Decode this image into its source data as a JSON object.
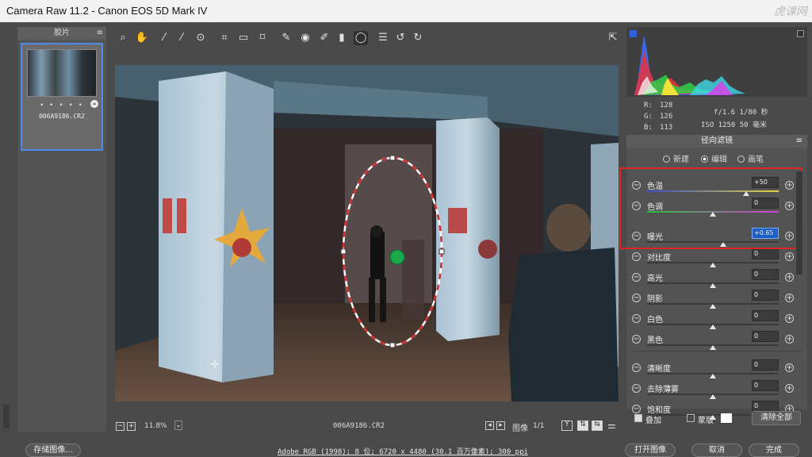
{
  "window": {
    "title": "Camera Raw 11.2 -  Canon EOS 5D Mark IV",
    "watermark": "虎课网"
  },
  "filmstrip": {
    "header": "胶片",
    "thumb_dots": "• • • • •",
    "thumb_filename": "006A9186.CR2"
  },
  "toolbar": {
    "tools": [
      "zoom-icon",
      "hand-icon",
      "white-balance-icon",
      "color-sampler-icon",
      "target-adjust-icon",
      "crop-icon",
      "straighten-icon",
      "transform-icon",
      "spot-removal-icon",
      "red-eye-icon",
      "adjustment-brush-icon",
      "graduated-filter-icon",
      "radial-filter-icon",
      "preferences-list-icon",
      "rotate-ccw-icon",
      "rotate-cw-icon"
    ],
    "fullscreen_icon": "fullscreen-icon"
  },
  "canvas": {
    "zoom": "11.8%",
    "filename": "006A9186.CR2",
    "image_label": "图像",
    "image_count": "1/1"
  },
  "histogram": {
    "colors": {
      "red": "#e8323a",
      "green": "#2fd04a",
      "blue": "#3b6cff",
      "yellow": "#f0e238",
      "magenta": "#e23ce8",
      "cyan": "#3ed8e8"
    }
  },
  "info": {
    "r_label": "R:",
    "r": "128",
    "g_label": "G:",
    "g": "126",
    "b_label": "B:",
    "b": "113",
    "aperture_shutter": "f/1.6   1/80 秒",
    "iso_focal": "ISO 1250   50 毫米"
  },
  "panel": {
    "title": "径向滤镜",
    "modes": [
      {
        "label": "新建",
        "selected": false
      },
      {
        "label": "编辑",
        "selected": true
      },
      {
        "label": "画笔",
        "selected": false
      }
    ],
    "sliders": [
      {
        "label": "色温",
        "value": "+50",
        "level": 0.75,
        "selected": false
      },
      {
        "label": "色调",
        "value": "0",
        "level": 0.5,
        "selected": false
      },
      {
        "label": "曝光",
        "value": "+0.65",
        "level": 0.58,
        "selected": true
      },
      {
        "label": "对比度",
        "value": "0",
        "level": 0.5,
        "selected": false
      },
      {
        "label": "高光",
        "value": "0",
        "level": 0.5,
        "selected": false
      },
      {
        "label": "阴影",
        "value": "0",
        "level": 0.5,
        "selected": false
      },
      {
        "label": "白色",
        "value": "0",
        "level": 0.5,
        "selected": false
      },
      {
        "label": "黑色",
        "value": "0",
        "level": 0.5,
        "selected": false
      },
      {
        "label": "清晰度",
        "value": "0",
        "level": 0.5,
        "selected": false
      },
      {
        "label": "去除薄雾",
        "value": "0",
        "level": 0.5,
        "selected": false
      },
      {
        "label": "饱和度",
        "value": "0",
        "level": 0.5,
        "selected": false
      }
    ],
    "overlay_label": "叠加",
    "mask_label": "蒙版",
    "clear_all": "清除全部"
  },
  "bottom": {
    "save_image": "存储图像...",
    "workflow_link": "Adobe RGB (1998); 8 位; 6720 x 4480 (30.1 百万像素); 300 ppi",
    "open_image": "打开图像",
    "cancel": "取消",
    "done": "完成"
  }
}
